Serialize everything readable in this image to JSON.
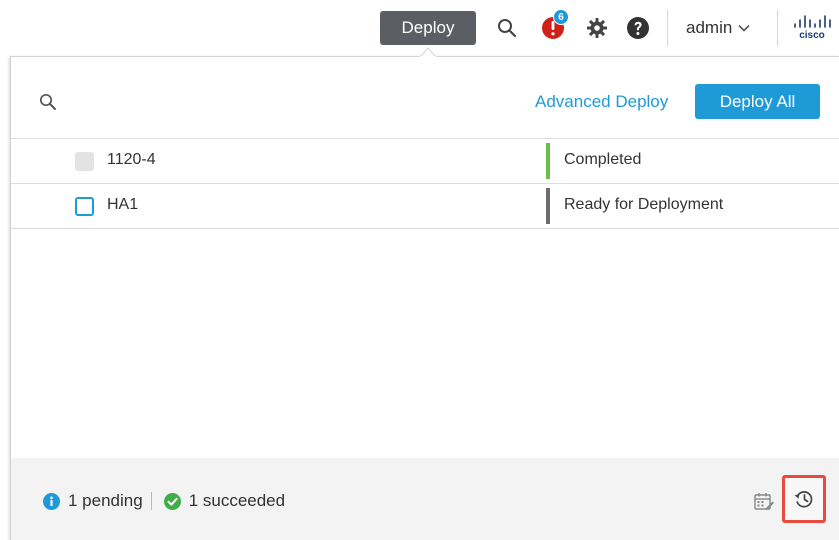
{
  "topbar": {
    "deploy_label": "Deploy",
    "alert_count": "6",
    "user_label": "admin",
    "logo_text": "cisco"
  },
  "panel": {
    "advanced_deploy_label": "Advanced Deploy",
    "deploy_all_label": "Deploy All",
    "devices": [
      {
        "name": "1120-4",
        "status": "Completed",
        "status_color": "#6cc04a",
        "checkbox": "disabled"
      },
      {
        "name": "HA1",
        "status": "Ready for Deployment",
        "status_color": "#6d6d6d",
        "checkbox": "unchecked"
      }
    ]
  },
  "footer": {
    "pending_label": "1 pending",
    "succeeded_label": "1 succeeded"
  },
  "colors": {
    "accent": "#1e9ad6",
    "alert": "#d0201a",
    "success": "#3fae49",
    "highlight": "#e84a3c"
  }
}
